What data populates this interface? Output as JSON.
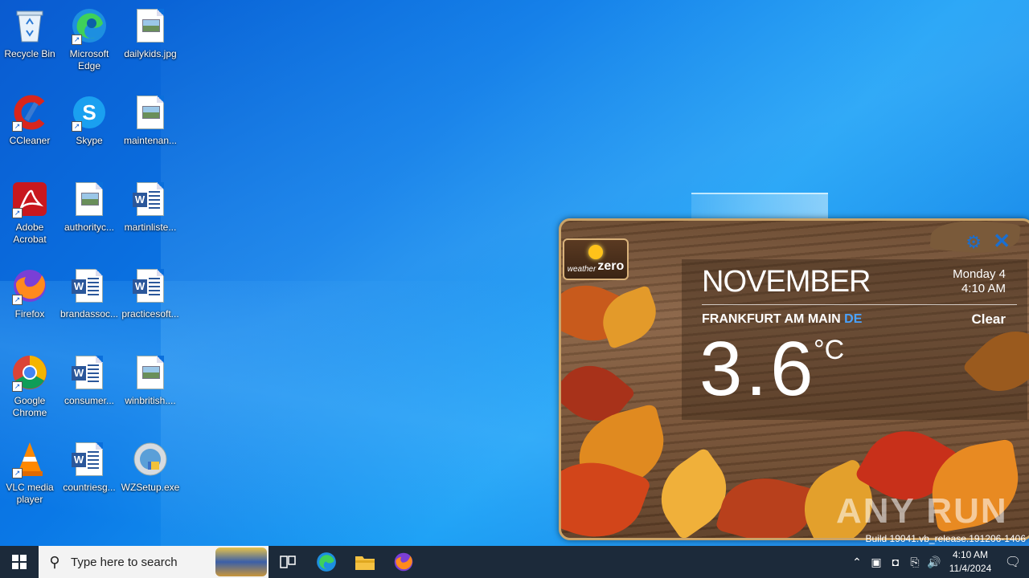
{
  "desktop": {
    "icons": [
      {
        "label": "Recycle Bin",
        "icon": "recycle-bin-icon"
      },
      {
        "label": "Microsoft Edge",
        "icon": "edge-icon"
      },
      {
        "label": "dailykids.jpg",
        "icon": "image-file-icon"
      },
      {
        "label": "CCleaner",
        "icon": "ccleaner-icon"
      },
      {
        "label": "Skype",
        "icon": "skype-icon"
      },
      {
        "label": "maintenan...",
        "icon": "image-file-icon"
      },
      {
        "label": "Adobe Acrobat",
        "icon": "acrobat-icon"
      },
      {
        "label": "authorityc...",
        "icon": "image-file-icon"
      },
      {
        "label": "martinliste...",
        "icon": "word-doc-icon"
      },
      {
        "label": "Firefox",
        "icon": "firefox-icon"
      },
      {
        "label": "brandassoc...",
        "icon": "word-doc-icon"
      },
      {
        "label": "practicesoft...",
        "icon": "word-doc-icon"
      },
      {
        "label": "Google Chrome",
        "icon": "chrome-icon"
      },
      {
        "label": "consumer...",
        "icon": "word-doc-icon"
      },
      {
        "label": "winbritish....",
        "icon": "image-file-icon"
      },
      {
        "label": "VLC media player",
        "icon": "vlc-icon"
      },
      {
        "label": "countriesg...",
        "icon": "word-doc-icon"
      },
      {
        "label": "WZSetup.exe",
        "icon": "installer-icon"
      }
    ]
  },
  "weather_widget": {
    "logo_small": "weather",
    "logo_big": "zero",
    "month": "NOVEMBER",
    "day": "Monday 4",
    "time": "4:10 AM",
    "city": "FRANKFURT AM MAIN",
    "country": "DE",
    "condition": "Clear",
    "temperature": "3.6",
    "unit": "°C",
    "settings_icon": "gear-icon",
    "close_icon": "close-icon",
    "accent_color": "#1a6fd0"
  },
  "watermark": "ANY RUN",
  "build_text": "Build 19041.vb_release.191206-1406",
  "taskbar": {
    "search_placeholder": "Type here to search",
    "apps": [
      "task-view-icon",
      "edge-icon",
      "file-explorer-icon",
      "firefox-icon"
    ],
    "clock_time": "4:10 AM",
    "clock_date": "11/4/2024"
  }
}
